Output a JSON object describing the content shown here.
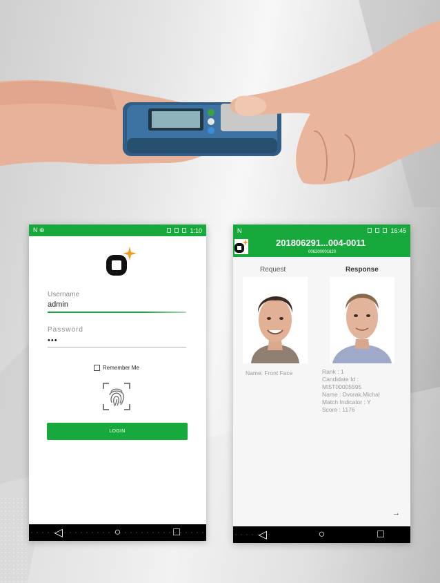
{
  "login_screen": {
    "status": {
      "left": "N ⊛",
      "time": "1:10"
    },
    "username_label": "Username",
    "username_value": "admin",
    "password_label": "Password",
    "password_value": "•••",
    "remember_label": "Remember Me",
    "login_label": "LOGIN"
  },
  "result_screen": {
    "status": {
      "left": "N",
      "time": "16:45"
    },
    "title": "201806291...004-0011",
    "subtitle": "006200001620",
    "request_label": "Request",
    "response_label": "Response",
    "request_name": "Name: Front Face",
    "response_lines": [
      "Rank : 1",
      "Candidate Id :",
      "MI5T00005595",
      "Name : Dvorak,Michal",
      "Match Indicator : Y",
      "Score : 1176"
    ],
    "next_arrow": "→"
  },
  "nav": {
    "back": "◁",
    "home": "○",
    "recent": "□"
  },
  "colors": {
    "accent": "#17a93b",
    "logo_star": "#f39a1f"
  }
}
